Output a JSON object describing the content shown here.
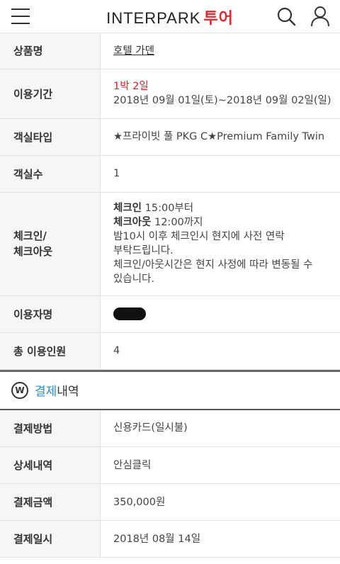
{
  "header": {
    "logo_text": "INTERPARK",
    "logo_accent": "투어"
  },
  "reservation": {
    "rows": [
      {
        "label": "상품명",
        "value": "호텔 가덴"
      },
      {
        "label": "이용기간",
        "nights": "1박 2일",
        "value": "2018년 09월 01일(토)~2018년 09월 02일(일)"
      },
      {
        "label": "객실타입",
        "value": "★프라이빗 풀 PKG C★Premium Family Twin"
      },
      {
        "label": "객실수",
        "value": "1"
      },
      {
        "label": "체크인/",
        "label2": "체크아웃",
        "checkin_label": "체크인",
        "checkin_time": "15:00부터",
        "checkout_label": "체크아웃",
        "checkout_time": "12:00까지",
        "note1": "밤10시 이후 체크인시 현지에 사전 연락",
        "note2": "부탁드립니다.",
        "note3": "체크인/아웃시간은 현지 사정에 따라 변동될 수",
        "note4": "있습니다."
      },
      {
        "label": "이용자명",
        "value": ""
      },
      {
        "label": "총 이용인원",
        "value": "4"
      }
    ]
  },
  "payment_section": {
    "icon": "W",
    "title_accent": "결제",
    "title_rest": "내역",
    "rows": [
      {
        "label": "결제방법",
        "value": "신용카드(일시불)"
      },
      {
        "label": "상세내역",
        "value": "안심클릭"
      },
      {
        "label": "결제금액",
        "value": "350,000원"
      },
      {
        "label": "결제일시",
        "value": "2018년 08월 14일"
      }
    ]
  },
  "colors": {
    "accent_red": "#d0262e",
    "accent_blue": "#2e8bc7"
  }
}
